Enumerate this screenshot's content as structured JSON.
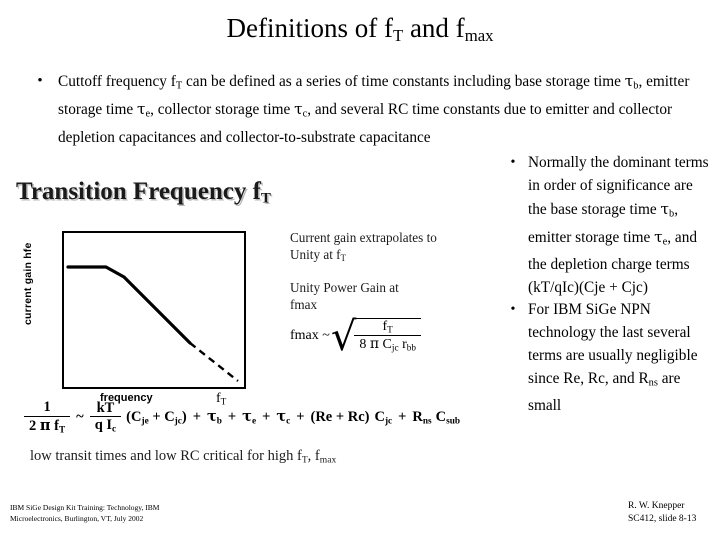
{
  "slide": {
    "title_parts": [
      "Definitions of f",
      "T",
      " and f",
      "max"
    ],
    "title_plain": "Definitions of fT and fmax"
  },
  "top_bullet": {
    "marker": "•",
    "line1_a": "Cuttoff frequency f",
    "line1_sub": "T",
    "line1_b": " can be defined as a series of time constants including base storage time ",
    "tau_b": "τ",
    "sub_b": "b",
    "line2_a": ", emitter storage time ",
    "tau_e": "τ",
    "sub_e": "e",
    "line2_b": ", collector storage time ",
    "tau_c": "τ",
    "sub_c": "c",
    "line3": ", and several RC time constants due to emitter and collector depletion capacitances and collector-to-substrate capacitance"
  },
  "right_bullets": [
    {
      "marker": "•",
      "part1": "Normally the dominant terms in order of significance are the base storage time ",
      "tau1": "τ",
      "sub1": "b",
      "part2": ", emitter storage time ",
      "tau2": "τ",
      "sub2": "e",
      "part3": ", and the depletion charge terms (kT/qIc)(Cje + Cjc)"
    },
    {
      "marker": "•",
      "part1": "For IBM SiGe NPN technology the last several terms are usually negligible since Re, Rc, and R",
      "sub1": "ns",
      "part2": " are small"
    }
  ],
  "embedded_image": {
    "heading_text": "Transition Frequency f",
    "heading_sub": "T",
    "chart": {
      "ylabel": "current gain  hfe",
      "xlabel": "frequency",
      "ft_label": "f",
      "ft_sub": "T",
      "solid_curve": "flat low-frequency plateau then -20dB/decade roll-off",
      "dashed_curve": "extrapolation of roll-off down to unity gain at fT"
    },
    "note_a": "Current gain extrapolates to\nUnity at f",
    "note_a_sub": "T",
    "note_b": "Unity Power Gain at\nfmax",
    "fmax_equation": {
      "lead": "fmax ~",
      "numerator": "f",
      "numerator_sub": "T",
      "den_1": "8",
      "den_pi": "π",
      "den_c": "C",
      "den_c_sub": "jc",
      "den_r": "r",
      "den_r_sub": "bb"
    },
    "tau_equation": {
      "lhs_num": "1",
      "lhs_den_1": "2",
      "lhs_den_pi": "π",
      "lhs_den_f": "f",
      "lhs_den_f_sub": "T",
      "approx": "~",
      "kt_num": "kT",
      "kt_den_q": "q I",
      "kt_den_sub": "c",
      "term_cj": "(C",
      "term_cj_sub1": "je",
      "term_cj_mid": " + C",
      "term_cj_sub2": "jc",
      "term_cj_end": ")",
      "plus": "+",
      "tau": "τ",
      "tau_sub_b": "b",
      "tau_sub_e": "e",
      "tau_sub_c": "c",
      "re_rc": "(Re + Rc)",
      "cjc": "C",
      "cjc_sub": "jc",
      "rns": "R",
      "rns_sub": "ns",
      "csub": "C",
      "csub_sub": "sub"
    },
    "footer_text_a": "low transit times and low RC critical for high f",
    "footer_sub_a": "T",
    "footer_text_b": ", f",
    "footer_sub_b": "max"
  },
  "footer": {
    "left_line1": "IBM SiGe Design Kit Training:  Technology, IBM",
    "left_line2": "Microelectronics, Burlington, VT, July 2002",
    "right_line1": "R. W. Knepper",
    "right_line2": "SC412, slide 8-13"
  },
  "colors": {
    "background": "#ffffff",
    "text": "#000000",
    "heading_shadow": "#b9b9b9"
  }
}
